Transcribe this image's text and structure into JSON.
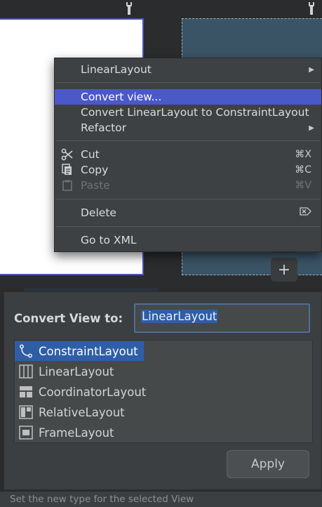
{
  "editor": {
    "wrench_icon": "wrench-icon",
    "plus_icon": "plus-icon",
    "plus_glyph": "+"
  },
  "context_menu": {
    "items": [
      {
        "label": "LinearLayout",
        "has_submenu": true
      },
      {
        "label": "Convert view...",
        "selected": true
      },
      {
        "label": "Convert LinearLayout to ConstraintLayout"
      },
      {
        "label": "Refactor",
        "has_submenu": true
      },
      {
        "label": "Cut",
        "shortcut": "⌘X",
        "icon": "scissors-icon"
      },
      {
        "label": "Copy",
        "shortcut": "⌘C",
        "icon": "copy-icon"
      },
      {
        "label": "Paste",
        "shortcut": "⌘V",
        "icon": "paste-icon",
        "disabled": true
      },
      {
        "label": "Delete",
        "shortcut": "⌦",
        "shortcut_icon": "delete-key-icon"
      },
      {
        "label": "Go to XML"
      }
    ],
    "submenu_arrow": "▶"
  },
  "dialog": {
    "label": "Convert View to:",
    "field_value": "LinearLayout",
    "types": [
      {
        "label": "ConstraintLayout",
        "icon": "constraint-layout-icon",
        "selected": true
      },
      {
        "label": "LinearLayout",
        "icon": "linear-layout-icon"
      },
      {
        "label": "CoordinatorLayout",
        "icon": "coordinator-layout-icon"
      },
      {
        "label": "RelativeLayout",
        "icon": "relative-layout-icon"
      },
      {
        "label": "FrameLayout",
        "icon": "frame-layout-icon"
      }
    ],
    "apply_label": "Apply"
  },
  "status": "Set the new type for the selected View",
  "colors": {
    "menu_selection": "#4b58c8",
    "list_selection": "#2f5ea6",
    "blueprint": "#3a5466",
    "panel": "#3c3f41"
  }
}
